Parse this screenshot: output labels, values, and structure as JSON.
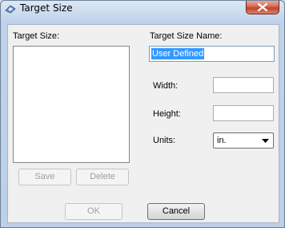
{
  "window": {
    "title": "Target Size",
    "close_icon": "close-icon",
    "app_icon": "scanner-icon"
  },
  "left": {
    "list_label": "Target Size:",
    "save_label": "Save",
    "delete_label": "Delete"
  },
  "right": {
    "name_label": "Target Size Name:",
    "name_value": "User Defined",
    "width_label": "Width:",
    "width_value": "",
    "height_label": "Height:",
    "height_value": "",
    "units_label": "Units:",
    "units_value": "in."
  },
  "footer": {
    "ok_label": "OK",
    "cancel_label": "Cancel"
  },
  "colors": {
    "selection": "#3399ff",
    "close_button": "#c3422a"
  }
}
